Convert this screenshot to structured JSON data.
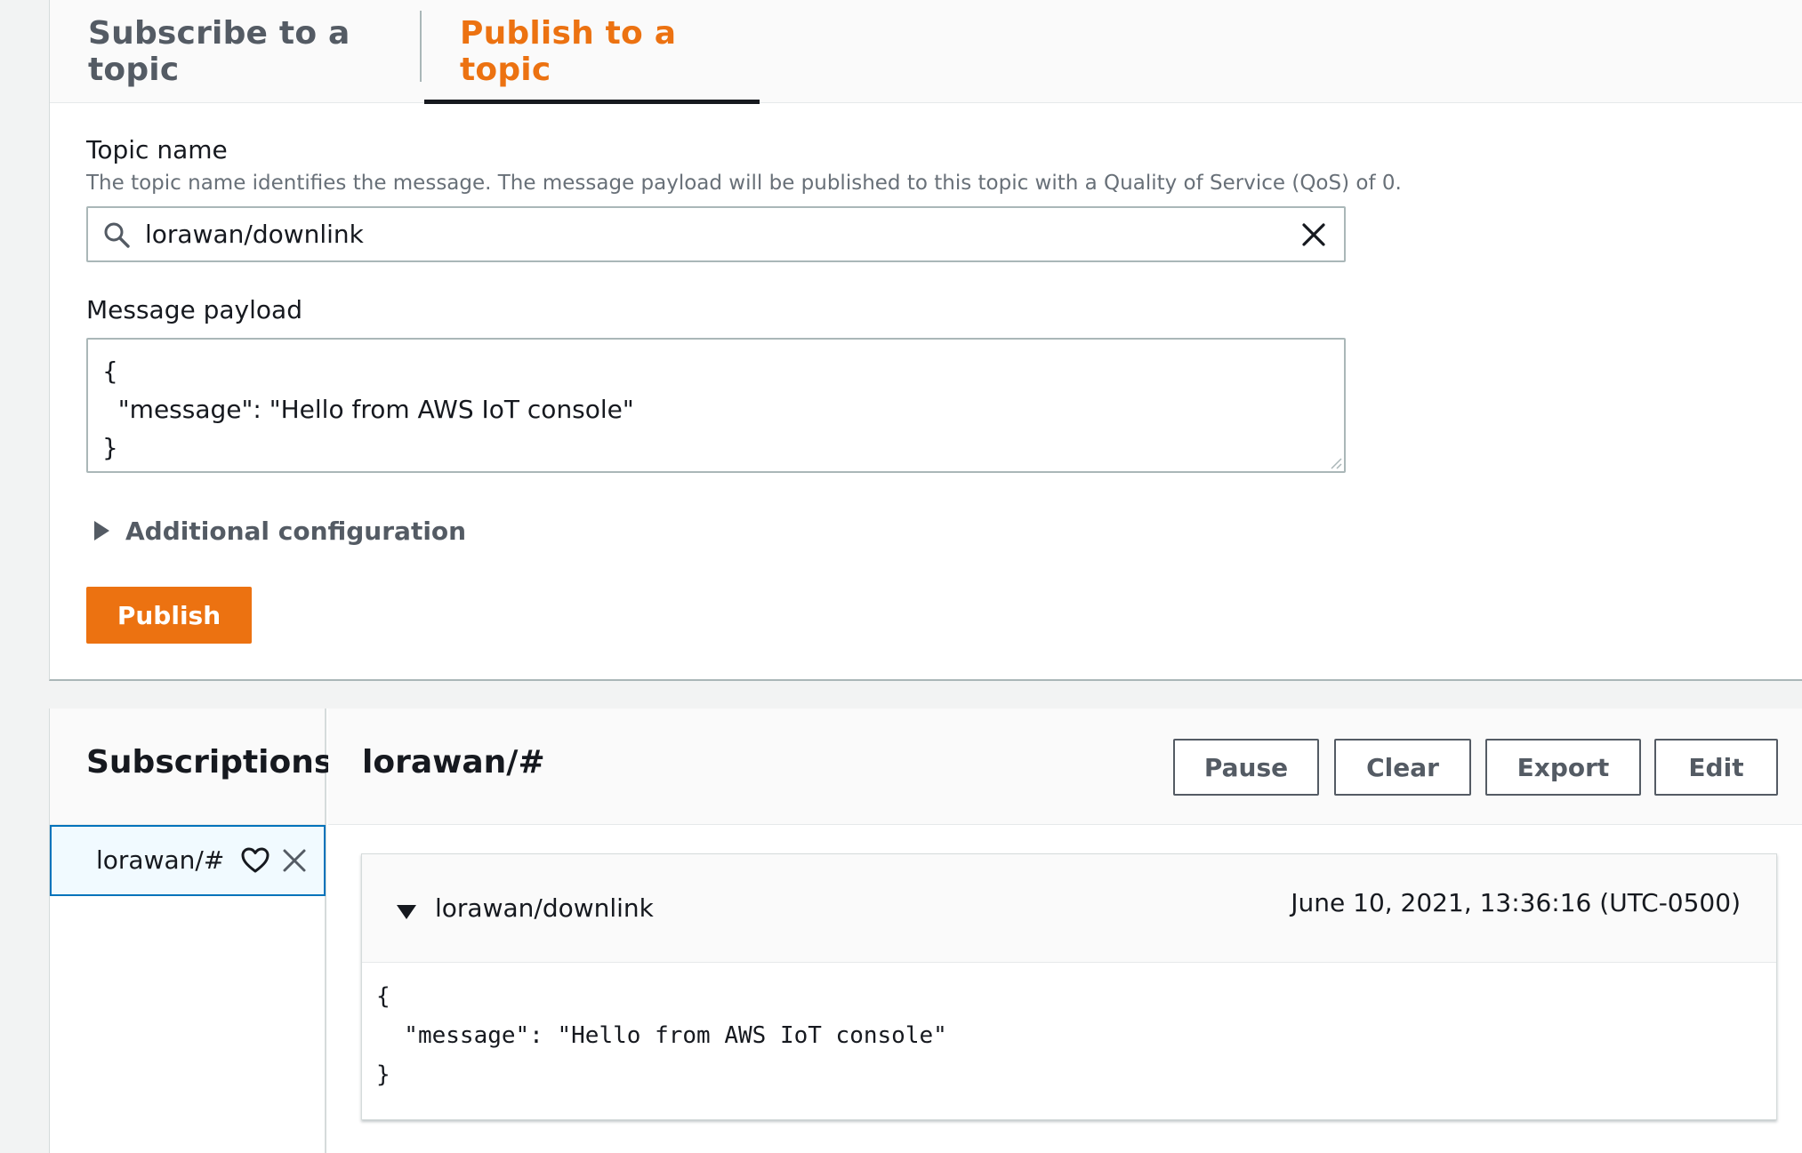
{
  "tabs": {
    "subscribe": "Subscribe to a topic",
    "publish": "Publish to a topic",
    "active": "publish"
  },
  "publish_form": {
    "topic_label": "Topic name",
    "topic_description": "The topic name identifies the message. The message payload will be published to this topic with a Quality of Service (QoS) of 0.",
    "topic_value": "lorawan/downlink",
    "payload_label": "Message payload",
    "payload_lines": [
      "{",
      "  \"message\": \"Hello from AWS IoT console\"",
      "}"
    ],
    "additional_config_label": "Additional configuration",
    "publish_button": "Publish"
  },
  "subscriptions": {
    "title": "Subscriptions",
    "items": [
      {
        "label": "lorawan/#",
        "selected": true
      }
    ]
  },
  "subscription_view": {
    "title": "lorawan/#",
    "buttons": {
      "pause": "Pause",
      "clear": "Clear",
      "export": "Export",
      "edit": "Edit"
    },
    "messages": [
      {
        "topic": "lorawan/downlink",
        "timestamp": "June 10, 2021, 13:36:16 (UTC-0500)",
        "body_lines": [
          "{",
          "  \"message\": \"Hello from AWS IoT console\"",
          "}"
        ]
      }
    ]
  },
  "colors": {
    "accent": "#ec7211",
    "text": "#16191f",
    "muted": "#545b64",
    "selected_border": "#0073bb",
    "selected_bg": "#f1faff"
  },
  "icons": {
    "search": "search-icon",
    "clear": "close-icon",
    "expand": "caret-right-icon",
    "collapse": "caret-down-icon",
    "favorite": "heart-icon",
    "remove": "close-icon"
  }
}
